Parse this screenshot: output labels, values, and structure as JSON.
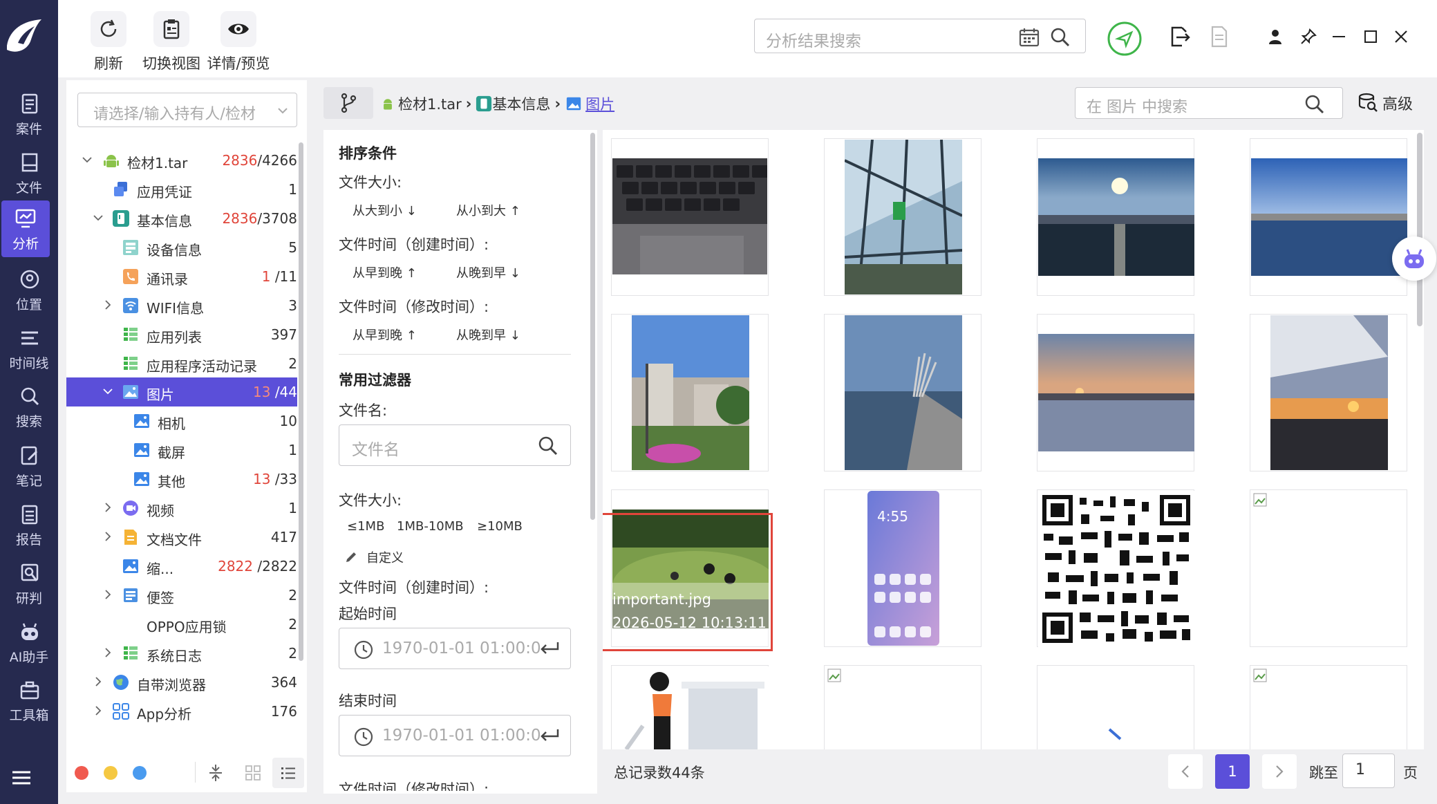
{
  "toolbar": {
    "refresh_label": "刷新",
    "switch_view_label": "切换视图",
    "details_label": "详情/预览",
    "search_placeholder": "分析结果搜索"
  },
  "leftnav": {
    "items": [
      {
        "label": "案件",
        "icon": "case-icon"
      },
      {
        "label": "文件",
        "icon": "file-icon"
      },
      {
        "label": "分析",
        "icon": "analysis-icon"
      },
      {
        "label": "位置",
        "icon": "location-icon"
      },
      {
        "label": "时间线",
        "icon": "timeline-icon"
      },
      {
        "label": "搜索",
        "icon": "search-icon"
      },
      {
        "label": "笔记",
        "icon": "note-icon"
      },
      {
        "label": "报告",
        "icon": "report-icon"
      },
      {
        "label": "研判",
        "icon": "judge-icon"
      },
      {
        "label": "AI助手",
        "icon": "ai-assistant-icon"
      },
      {
        "label": "工具箱",
        "icon": "toolbox-icon"
      }
    ],
    "active": "分析"
  },
  "tree": {
    "select_placeholder": "请选择/输入持有人/检材",
    "rows": [
      {
        "label": "检材1.tar",
        "count_red": "2836",
        "count": "/4266"
      },
      {
        "label": "应用凭证",
        "count_red": "",
        "count": "1"
      },
      {
        "label": "基本信息",
        "count_red": "2836",
        "count": "/3708"
      },
      {
        "label": "设备信息",
        "count_red": "",
        "count": "5"
      },
      {
        "label": "通讯录",
        "count_red": "1",
        "count": "/11"
      },
      {
        "label": "WIFI信息",
        "count_red": "",
        "count": "3"
      },
      {
        "label": "应用列表",
        "count_red": "",
        "count": "397"
      },
      {
        "label": "应用程序活动记录",
        "count_red": "",
        "count": "2"
      },
      {
        "label": "图片",
        "count_red": "13",
        "count": "/44"
      },
      {
        "label": "相机",
        "count_red": "",
        "count": "10"
      },
      {
        "label": "截屏",
        "count_red": "",
        "count": "1"
      },
      {
        "label": "其他",
        "count_red": "13",
        "count": "/33"
      },
      {
        "label": "视频",
        "count_red": "",
        "count": "1"
      },
      {
        "label": "文档文件",
        "count_red": "",
        "count": "417"
      },
      {
        "label": "缩...",
        "count_red": "2822",
        "count": "/2822"
      },
      {
        "label": "便签",
        "count_red": "",
        "count": "2"
      },
      {
        "label": "OPPO应用锁",
        "count_red": "",
        "count": "2"
      },
      {
        "label": "系统日志",
        "count_red": "",
        "count": "2"
      },
      {
        "label": "自带浏览器",
        "count_red": "",
        "count": "364"
      },
      {
        "label": "App分析",
        "count_red": "",
        "count": "176"
      }
    ]
  },
  "breadcrumb": {
    "items": [
      "检材1.tar",
      "基本信息",
      "图片"
    ],
    "search_placeholder": "在 图片 中搜索",
    "advanced_label": "高级"
  },
  "filter": {
    "sort_title": "排序条件",
    "size_label": "文件大小:",
    "size_desc": "从大到小",
    "size_asc": "从小到大",
    "ctime_label": "文件时间（创建时间）:",
    "mtime_label": "文件时间（修改时间）:",
    "early_to_late": "从早到晚",
    "late_to_early": "从晚到早",
    "common_title": "常用过滤器",
    "filename_label": "文件名:",
    "filename_placeholder": "文件名",
    "size_label2": "文件大小:",
    "size_opts": [
      "≤1MB",
      "1MB-10MB",
      "≥10MB"
    ],
    "custom_label": "自定义",
    "ctime_label2": "文件时间（创建时间）:",
    "start_label": "起始时间",
    "end_label": "结束时间",
    "time_placeholder": "1970-01-01 01:00:0",
    "mtime_label2": "文件时间（修改时间）:"
  },
  "grid": {
    "highlight_name": "important.jpg",
    "highlight_time": "2026-05-12 10:13:11"
  },
  "footer": {
    "total": "总记录数44条",
    "page": "1",
    "jump_label": "跳至",
    "jump_value": "1",
    "page_suffix": "页"
  },
  "colors": {
    "nav_bg": "#262a4f",
    "accent": "#5b4fd9",
    "red_count": "#e0453a",
    "highlight_border": "#e0453a"
  }
}
